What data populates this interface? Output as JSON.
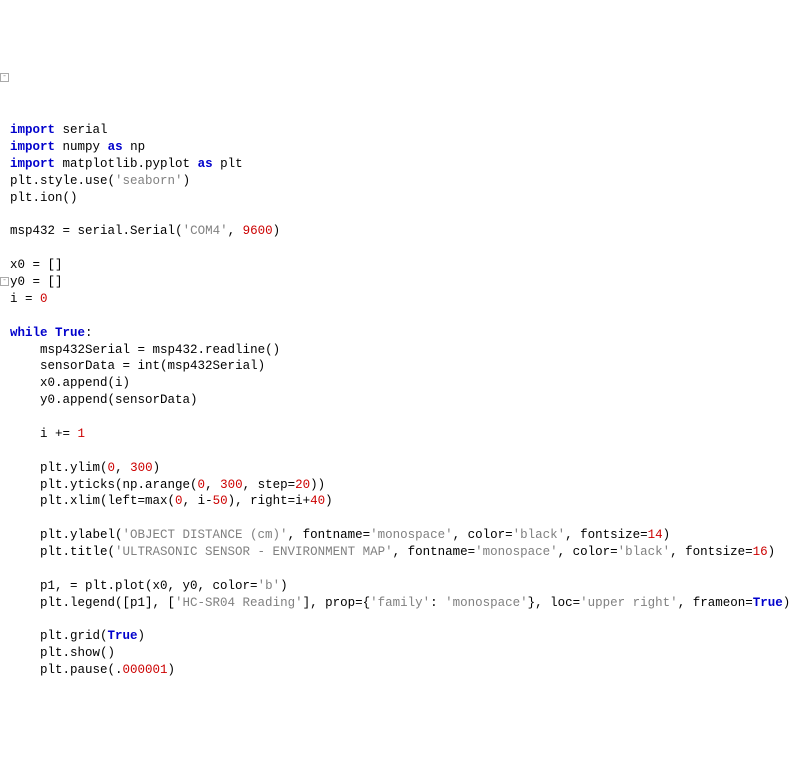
{
  "chart_data": null,
  "tokens": {
    "kw_import": "import",
    "kw_as": "as",
    "kw_while": "while",
    "kw_True": "True",
    "id_serial": "serial",
    "id_numpy": "numpy",
    "id_np": "np",
    "id_matplotlib_pyplot": "matplotlib.pyplot",
    "id_plt": "plt",
    "id_style_use": "plt.style.use",
    "str_seaborn": "'seaborn'",
    "id_plt_ion": "plt.ion",
    "id_msp432": "msp432",
    "eq": " = ",
    "id_serial_Serial": "serial.Serial",
    "str_com4": "'COM4'",
    "comma_sp": ", ",
    "num_9600": "9600",
    "id_x0": "x0",
    "id_y0": "y0",
    "empty_list": "[]",
    "id_i": "i",
    "num_0": "0",
    "colon": ":",
    "id_msp432Serial": "msp432Serial",
    "id_msp432_readline": "msp432.readline",
    "id_sensorData": "sensorData",
    "id_int_call": "int(msp432Serial)",
    "id_x0_append": "x0.append(i)",
    "id_y0_append": "y0.append(sensorData)",
    "id_i_pluseq": "i += ",
    "num_1": "1",
    "id_plt_ylim": "plt.ylim",
    "num_300": "300",
    "id_plt_yticks": "plt.yticks(np.arange(",
    "id_step_eq": ", step=",
    "num_20": "20",
    "close2": "))",
    "id_plt_xlim": "plt.xlim(left=max(",
    "id_i_minus": ", i-",
    "num_50": "50",
    "id_right_eq": "), right=i+",
    "num_40": "40",
    "close1": ")",
    "id_plt_ylabel": "plt.ylabel(",
    "str_obj_dist": "'OBJECT DISTANCE (cm)'",
    "id_fontname_eq": ", fontname=",
    "str_monospace": "'monospace'",
    "id_color_eq": ", color=",
    "str_black": "'black'",
    "id_fontsize_eq": ", fontsize=",
    "num_14": "14",
    "id_plt_title": "plt.title(",
    "str_title": "'ULTRASONIC SENSOR - ENVIRONMENT MAP'",
    "num_16": "16",
    "id_p1_assign": "p1, = plt.plot(x0, y0, color=",
    "str_b": "'b'",
    "id_plt_legend": "plt.legend([p1], [",
    "str_hcsr04": "'HC-SR04 Reading'",
    "id_prop_eq": "], prop={",
    "str_family": "'family'",
    "id_colon_sp": ": ",
    "id_close_brace": "}, loc=",
    "str_upper_right": "'upper right'",
    "id_frameon_eq": ", frameon=",
    "id_plt_grid": "plt.grid(",
    "id_plt_show": "plt.show()",
    "id_plt_pause": "plt.pause(.",
    "num_000001": "000001",
    "open_p": "(",
    "close_p": ")",
    "indent": "    "
  }
}
